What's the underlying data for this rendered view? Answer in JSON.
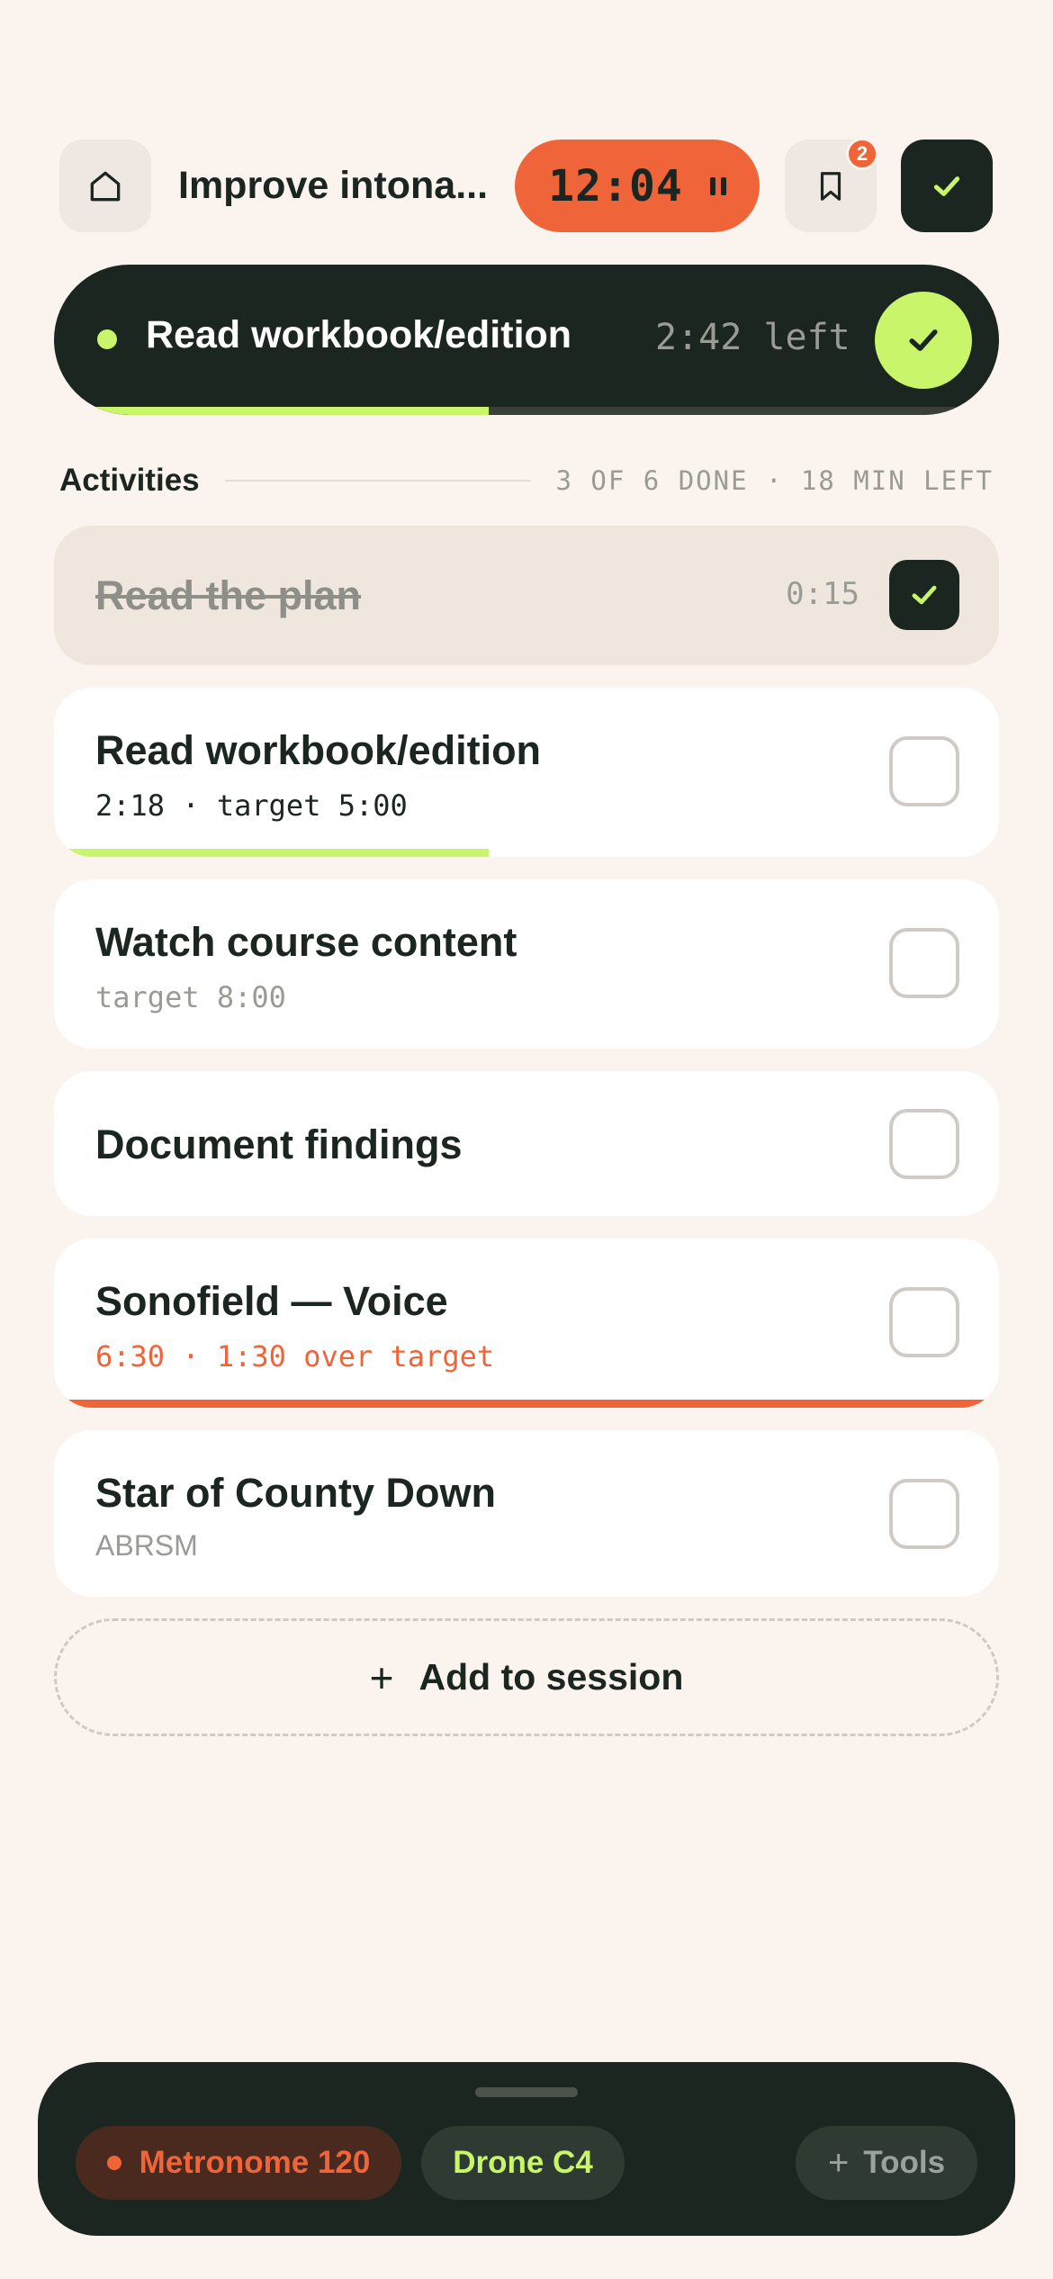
{
  "header": {
    "title": "Improve intona...",
    "timer": "12:04",
    "bookmark_badge": "2"
  },
  "current_activity": {
    "name": "Read workbook/edition",
    "time_left": "2:42 left",
    "progress": 0.46
  },
  "activities": {
    "label": "Activities",
    "summary": "3 OF 6 DONE · 18 MIN LEFT",
    "items": [
      {
        "title": "Read the plan",
        "time": "0:15",
        "done": true
      },
      {
        "title": "Read workbook/edition",
        "subtitle": "2:18 · target 5:00",
        "done": false,
        "progress": 0.46
      },
      {
        "title": "Watch course content",
        "subtitle": "target 8:00",
        "done": false
      },
      {
        "title": "Document findings",
        "done": false
      },
      {
        "title": "Sonofield — Voice",
        "subtitle": "6:30 · 1:30 over target",
        "done": false,
        "progress": 1.0
      },
      {
        "title": "Star of County Down",
        "subtitle": "ABRSM",
        "done": false
      }
    ]
  },
  "add_session": {
    "plus": "+",
    "label": "Add to session"
  },
  "tools_bar": {
    "metronome": "Metronome 120",
    "drone": "Drone C4",
    "tools": "Tools",
    "tools_plus": "+"
  },
  "colors": {
    "background": "#fbf3ee",
    "dark": "#1b2621",
    "accent_orange": "#f0643a",
    "accent_lime": "#c8f56a",
    "muted": "#9b9b95"
  },
  "icons": [
    "home-icon",
    "pause-icon",
    "bookmark-icon",
    "check-icon",
    "plus-icon"
  ]
}
